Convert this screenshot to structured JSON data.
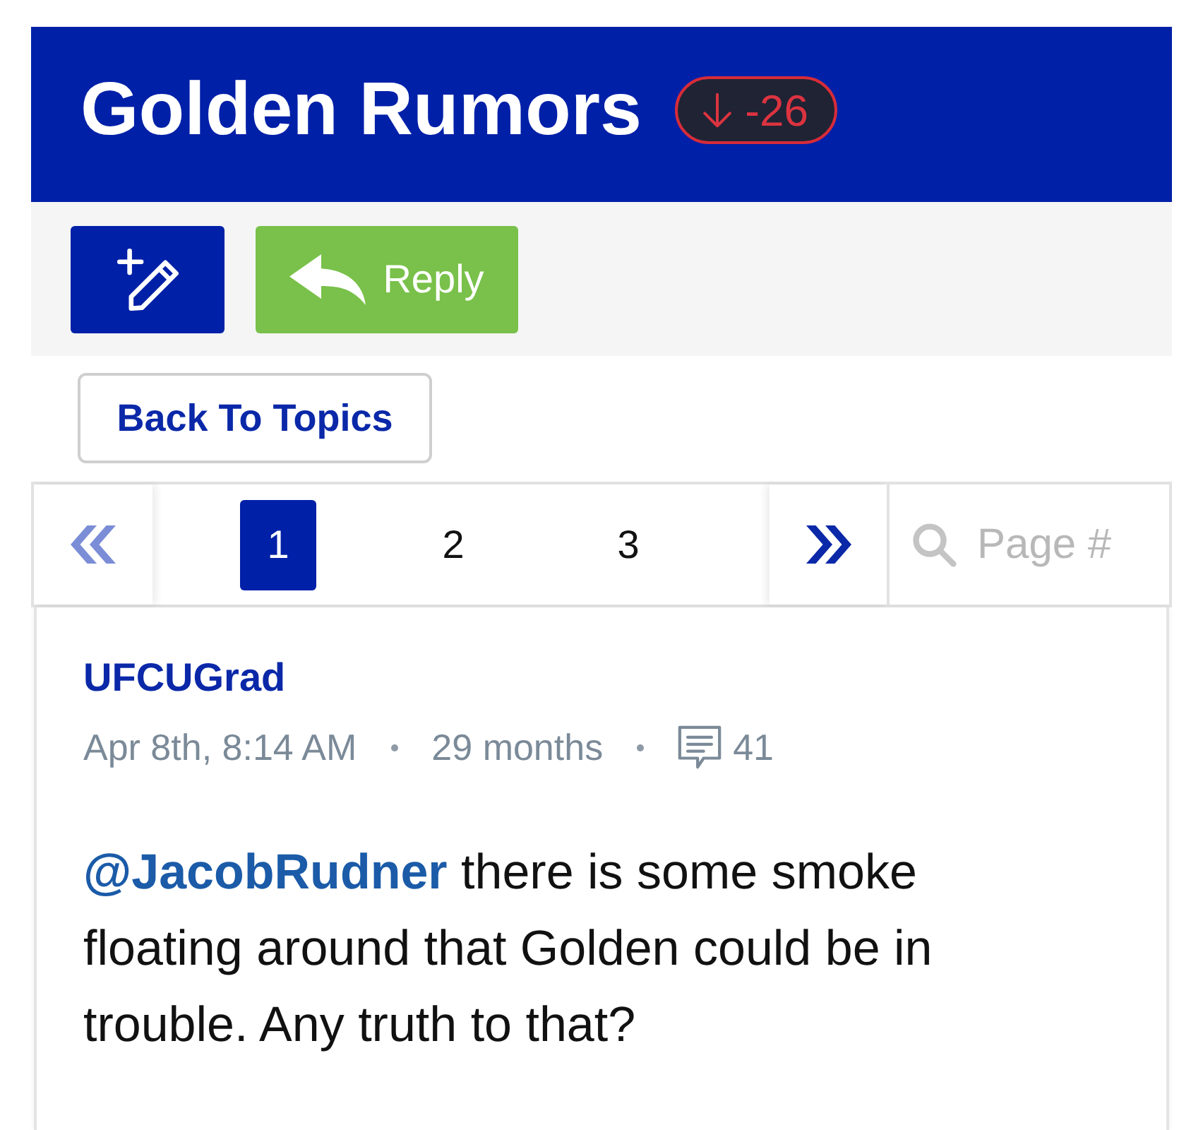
{
  "header": {
    "title": "Golden Rumors",
    "score": {
      "negative": true,
      "value": "-26"
    }
  },
  "toolbar": {
    "buttons": [
      {
        "kind": "new_post"
      },
      {
        "kind": "reply",
        "label": "Reply"
      }
    ]
  },
  "back_button": {
    "label": "Back To Topics"
  },
  "pagination": {
    "first": {
      "disabled": true
    },
    "pages": [
      {
        "label": "1",
        "selected": true
      },
      {
        "label": "2",
        "selected": false
      },
      {
        "label": "3",
        "selected": false
      }
    ],
    "last": {
      "disabled": false
    },
    "search": {
      "placeholder": "Page #"
    }
  },
  "post": {
    "author": "UFCUGrad",
    "date": "Apr 8th, 8:14 AM",
    "age": "29 months",
    "comment_count": "41",
    "mention": "@JacobRudner",
    "body": "there is some smoke floating around that Golden could be in trouble. Any truth to that?"
  }
}
